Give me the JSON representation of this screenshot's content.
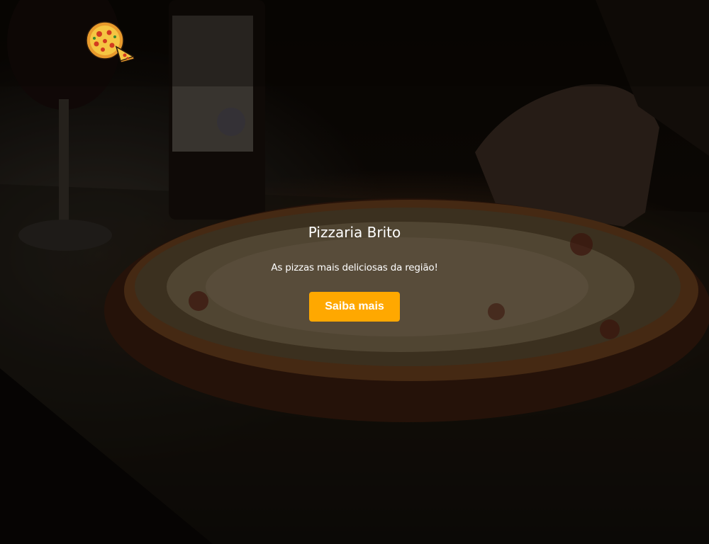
{
  "header": {
    "logo_icon": "pizza-icon"
  },
  "hero": {
    "title": "Pizzaria Brito",
    "subtitle": "As pizzas mais deliciosas da região!",
    "cta_label": "Saiba mais"
  },
  "colors": {
    "accent": "#ffa800",
    "text": "#ffffff",
    "background": "#0c0805"
  }
}
